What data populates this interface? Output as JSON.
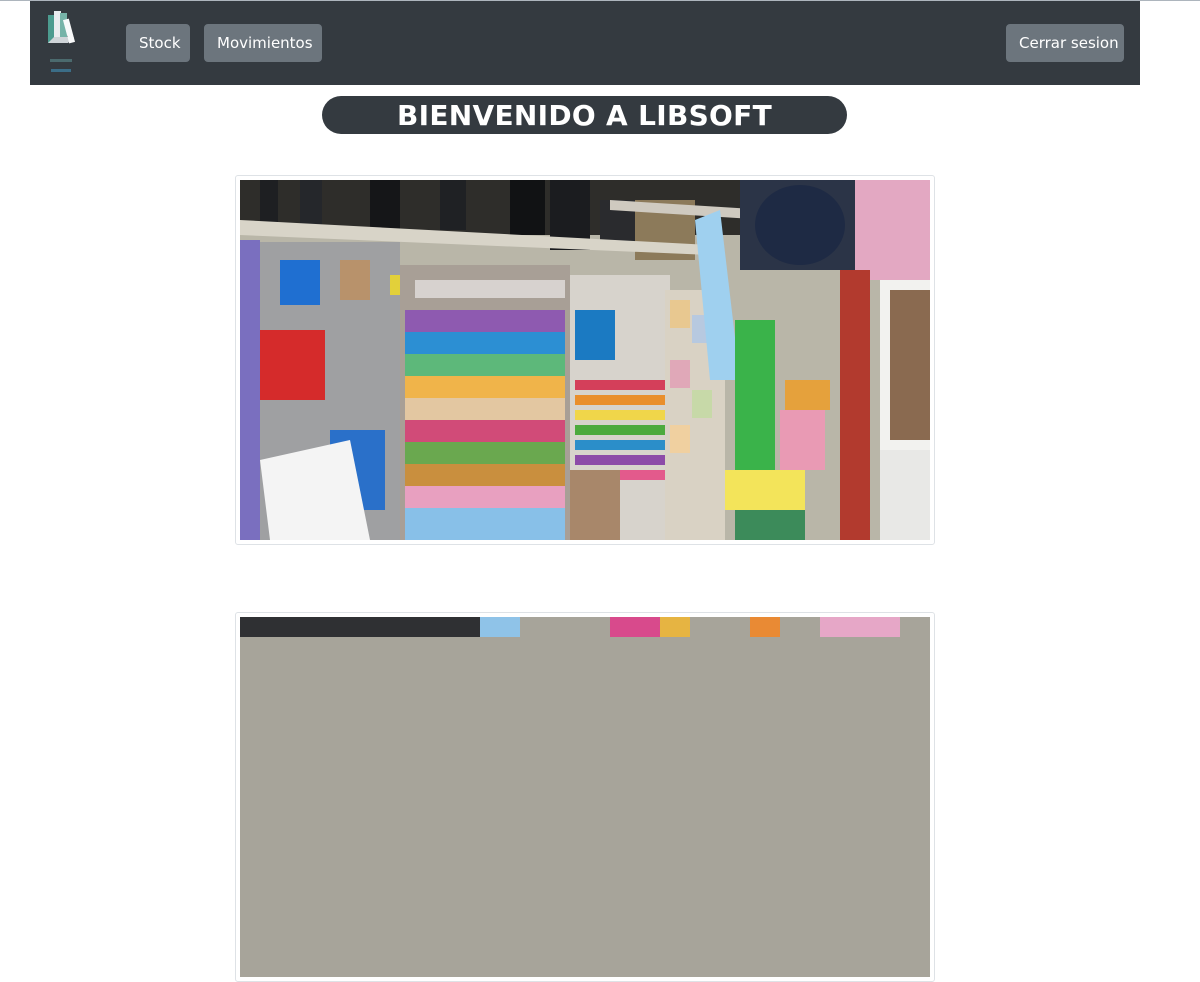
{
  "navbar": {
    "logo_icon": "libsoft-books-logo-icon",
    "stock_label": "Stock",
    "movimientos_label": "Movimientos",
    "logout_label": "Cerrar sesion"
  },
  "main": {
    "title": "BIENVENIDO A LIBSOFT",
    "carousel_images": [
      {
        "icon": "stationery-store-photo"
      },
      {
        "icon": "stationery-store-photo"
      }
    ]
  },
  "colors": {
    "navbar_bg": "#343a40",
    "button_bg": "#6c757d",
    "title_bg": "#343a40"
  }
}
